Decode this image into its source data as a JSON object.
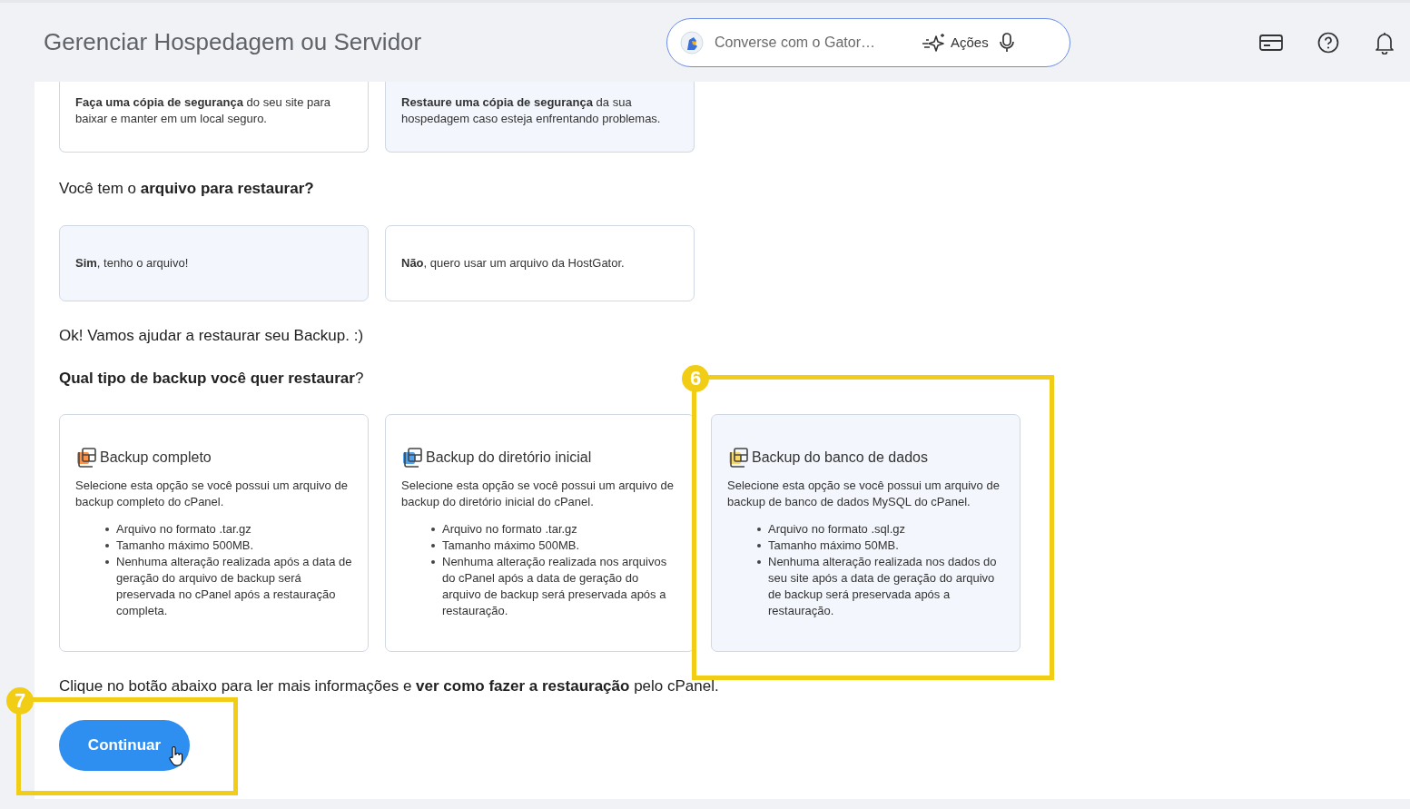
{
  "header": {
    "title": "Gerenciar Hospedagem ou Servidor",
    "chat": {
      "placeholder": "Converse com o Gator…",
      "actions_label": "Ações"
    }
  },
  "intro_cards": [
    {
      "description": "**Faça uma cópia de segurança** do seu site para baixar e manter em um local seguro.",
      "selected": false
    },
    {
      "description": "**Restaure uma cópia de segurança** da sua hospedagem caso esteja enfrentando problemas.",
      "selected": true
    }
  ],
  "file_question": "Você tem o **arquivo para restaurar?**",
  "file_options": [
    {
      "label": "**Sim**, tenho o arquivo!",
      "selected": true
    },
    {
      "label": "**Não**, quero usar um arquivo da HostGator.",
      "selected": false
    }
  ],
  "ok_message": "Ok! Vamos ajudar a restaurar seu Backup. :)",
  "type_question": "**Qual tipo de backup você quer restaurar**?",
  "backup_types": [
    {
      "title": "Backup completo",
      "color": "#f7934c",
      "description": "Selecione esta opção se você possui um arquivo de backup completo do cPanel.",
      "items": [
        "Arquivo no formato .tar.gz",
        "Tamanho máximo 500MB.",
        "Nenhuma alteração realizada após a data de geração do arquivo de backup será preservada no cPanel após a restauração completa."
      ],
      "selected": false
    },
    {
      "title": "Backup do diretório inicial",
      "color": "#4da3f0",
      "description": "Selecione esta opção se você possui um arquivo de backup do diretório inicial do cPanel.",
      "items": [
        "Arquivo no formato .tar.gz",
        "Tamanho máximo 500MB.",
        "Nenhuma alteração realizada nos arquivos do cPanel após a data de geração do arquivo de backup será preservada após a restauração."
      ],
      "selected": false
    },
    {
      "title": "Backup do banco de dados",
      "color": "#f5d76e",
      "description": "Selecione esta opção se você possui um arquivo de backup de banco de dados MySQL do cPanel.",
      "items": [
        "Arquivo no formato .sql.gz",
        "Tamanho máximo 50MB.",
        "Nenhuma alteração realizada nos dados do seu site após a data de geração do arquivo de backup será preservada após a restauração."
      ],
      "selected": true,
      "annotation": "6"
    }
  ],
  "instruction": "Clique no botão abaixo para ler mais informações e **ver como fazer a restauração** pelo cPanel.",
  "continue_button": {
    "label": "Continuar",
    "annotation": "7"
  }
}
